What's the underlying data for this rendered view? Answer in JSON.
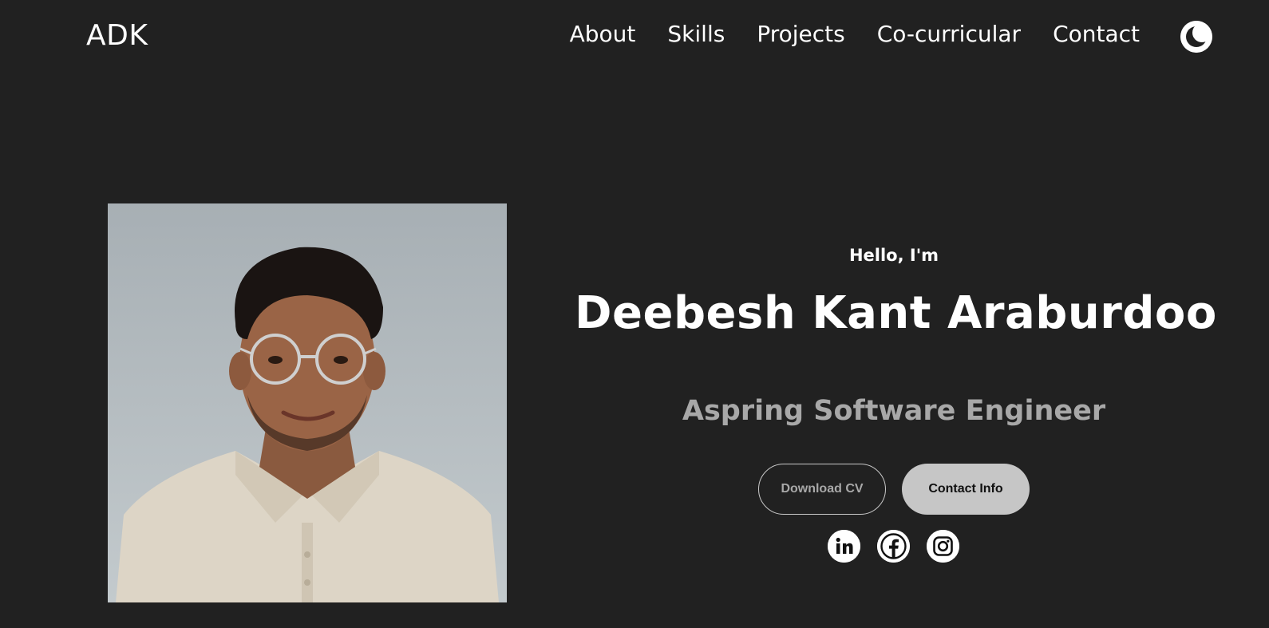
{
  "nav": {
    "logo": "ADK",
    "links": [
      {
        "label": "About"
      },
      {
        "label": "Skills"
      },
      {
        "label": "Projects"
      },
      {
        "label": "Co-curricular"
      },
      {
        "label": "Contact"
      }
    ],
    "theme_toggle_icon": "moon-icon"
  },
  "hero": {
    "greeting": "Hello, I'm",
    "name": "Deebesh Kant Araburdoo",
    "role": "Aspring Software Engineer",
    "buttons": {
      "download_cv": "Download CV",
      "contact_info": "Contact Info"
    },
    "socials": [
      {
        "icon": "linkedin-icon"
      },
      {
        "icon": "facebook-icon"
      },
      {
        "icon": "instagram-icon"
      }
    ]
  },
  "colors": {
    "background": "#212121",
    "text": "#ffffff",
    "muted": "#a8a8a8",
    "button_fill": "#c6c6c6"
  }
}
